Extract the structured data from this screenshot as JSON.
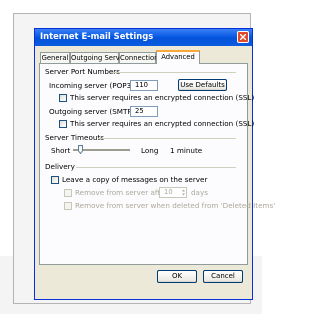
{
  "dialog": {
    "title": "Internet E-mail Settings"
  },
  "tabs": [
    {
      "label": "General"
    },
    {
      "label": "Outgoing Server"
    },
    {
      "label": "Connection"
    },
    {
      "label": "Advanced"
    }
  ],
  "server_ports": {
    "group_title": "Server Port Numbers",
    "incoming_label": "Incoming server (POP3):",
    "incoming_value": "110",
    "use_defaults_label": "Use Defaults",
    "incoming_ssl_label": "This server requires an encrypted connection (SSL)",
    "outgoing_label": "Outgoing server (SMTP):",
    "outgoing_value": "25",
    "outgoing_ssl_label": "This server requires an encrypted connection (SSL)"
  },
  "timeouts": {
    "group_title": "Server Timeouts",
    "short_label": "Short",
    "long_label": "Long",
    "value_label": "1 minute",
    "slider_level": 0.1
  },
  "delivery": {
    "group_title": "Delivery",
    "leave_copy_label": "Leave a copy of messages on the server",
    "remove_after_label": "Remove from server after",
    "remove_after_value": "10",
    "days_label": "days",
    "remove_deleted_label": "Remove from server when deleted from 'Deleted Items'"
  },
  "buttons": {
    "ok": "OK",
    "cancel": "Cancel"
  },
  "colors": {
    "title_bar": "#0a5ae6",
    "close": "#e04a2a",
    "tab_highlight": "#f8a93a"
  }
}
